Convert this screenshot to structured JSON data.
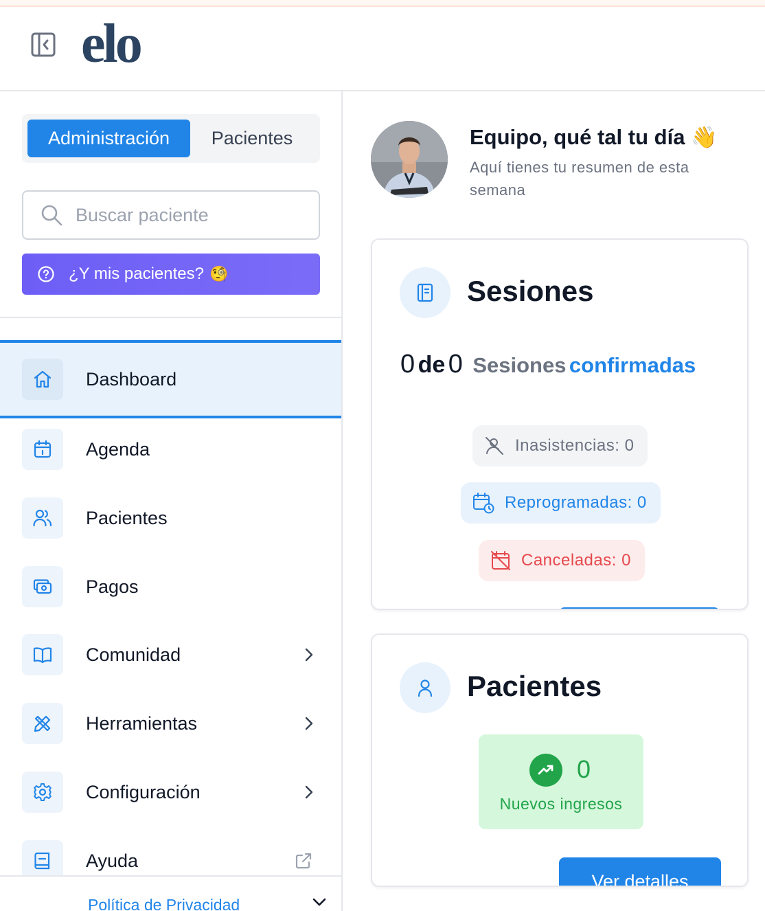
{
  "header": {
    "logo_text": "elo"
  },
  "sidebar": {
    "segment": {
      "active_label": "Administración",
      "inactive_label": "Pacientes"
    },
    "search": {
      "placeholder": "Buscar paciente",
      "value": ""
    },
    "help_button": {
      "label": "¿Y mis pacientes?",
      "emoji": "🧐"
    },
    "items": [
      {
        "label": "Dashboard",
        "icon": "home-icon",
        "active": true
      },
      {
        "label": "Agenda",
        "icon": "calendar-icon"
      },
      {
        "label": "Pacientes",
        "icon": "users-icon"
      },
      {
        "label": "Pagos",
        "icon": "cash-icon"
      },
      {
        "label": "Comunidad",
        "icon": "book-open-icon",
        "has_submenu": true
      },
      {
        "label": "Herramientas",
        "icon": "tools-icon",
        "has_submenu": true
      },
      {
        "label": "Configuración",
        "icon": "gear-icon",
        "has_submenu": true
      },
      {
        "label": "Ayuda",
        "icon": "book-icon",
        "external": true
      }
    ],
    "footer": {
      "privacy_label": "Política de Privacidad"
    }
  },
  "main": {
    "greeting": {
      "title": "Equipo, qué tal tu día",
      "emoji": "👋",
      "subtitle": "Aquí tienes tu resumen de esta semana"
    },
    "sessions_card": {
      "title": "Sesiones",
      "confirmed_count": "0",
      "connector": "de",
      "total_count": "0",
      "label": "Sesiones",
      "label_highlight": "confirmadas",
      "pills": {
        "absences": "Inasistencias: 0",
        "rescheduled": "Reprogramadas: 0",
        "cancelled": "Canceladas: 0"
      }
    },
    "patients_card": {
      "title": "Pacientes",
      "new_count": "0",
      "new_label": "Nuevos ingresos",
      "details_button": "Ver detalles"
    }
  },
  "colors": {
    "primary": "#2185e8",
    "help_button": "#6d5ef6",
    "success": "#22a44a",
    "danger": "#e5484d",
    "logo": "#2c4462"
  }
}
